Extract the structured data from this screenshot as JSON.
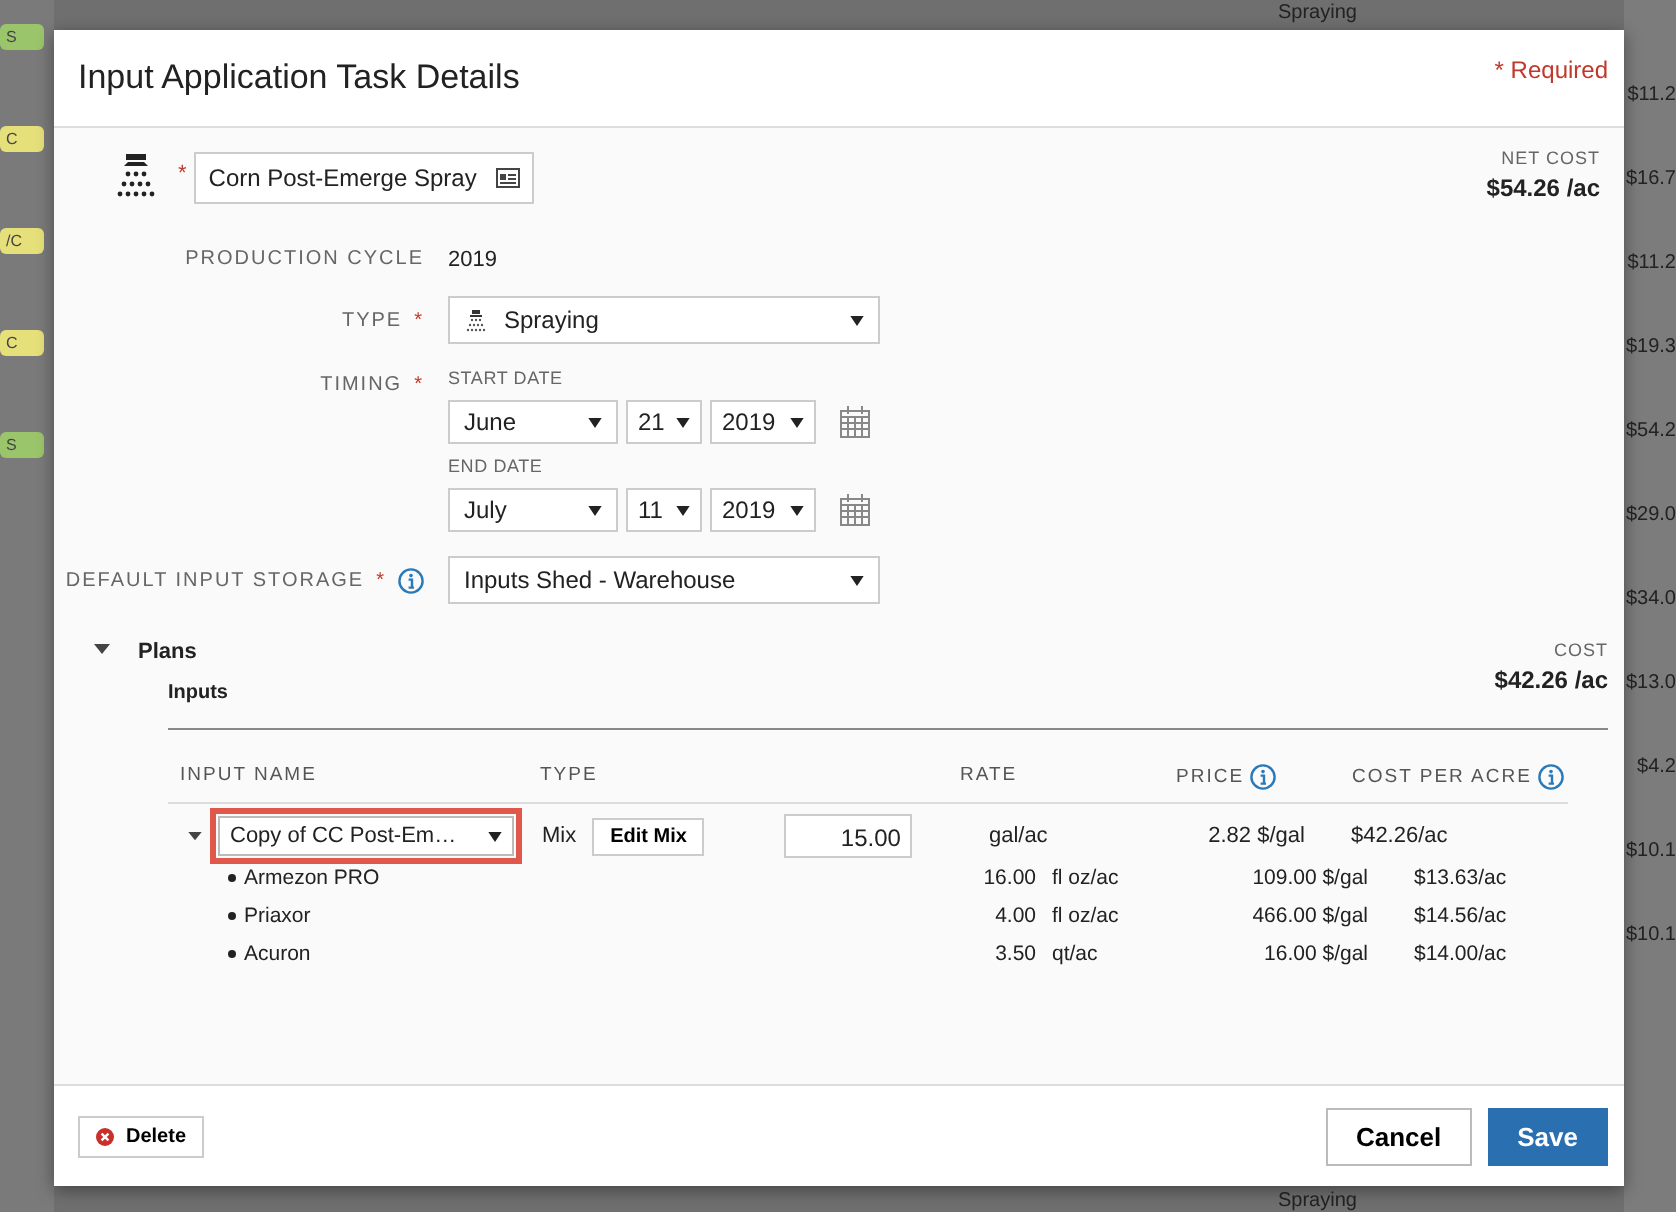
{
  "background": {
    "left_tags": [
      {
        "label": "S",
        "color": "#9bc56a"
      },
      {
        "label": "C",
        "color": "#e6e07a"
      },
      {
        "label": "/C",
        "color": "#e6e07a"
      },
      {
        "label": "C",
        "color": "#e6e07a"
      },
      {
        "label": "S",
        "color": "#9bc56a"
      }
    ],
    "right_top": "Spraying",
    "right_values": [
      "$11.2",
      "$16.7",
      "$11.2",
      "$19.3",
      "$54.2",
      "$29.0",
      "$34.0",
      "$13.0",
      "$4.2",
      "$10.1",
      "$10.1"
    ],
    "right_bottom": "Spraying"
  },
  "dialog": {
    "title": "Input Application Task Details",
    "required_note": "* Required",
    "task_name_mark": "*",
    "task_name": "Corn Post-Emerge Spray",
    "net_cost_label": "NET COST",
    "net_cost": "$54.26 /ac",
    "production_cycle": {
      "label": "PRODUCTION CYCLE",
      "value": "2019"
    },
    "type": {
      "label": "TYPE",
      "required_mark": "*",
      "value": "Spraying"
    },
    "timing": {
      "label": "TIMING",
      "required_mark": "*",
      "start_label": "START DATE",
      "start": {
        "month": "June",
        "day": "21",
        "year": "2019"
      },
      "end_label": "END DATE",
      "end": {
        "month": "July",
        "day": "11",
        "year": "2019"
      }
    },
    "storage": {
      "label": "DEFAULT INPUT STORAGE",
      "required_mark": "*",
      "value": "Inputs Shed - Warehouse"
    },
    "plans": {
      "title": "Plans",
      "expanded": true,
      "cost_label": "COST",
      "cost": "$42.26 /ac",
      "inputs_title": "Inputs",
      "columns": [
        "INPUT NAME",
        "TYPE",
        "RATE",
        "PRICE",
        "COST PER ACRE"
      ],
      "mix": {
        "name": "Copy of CC Post-Em…",
        "expanded": true,
        "highlighted": true,
        "type": "Mix",
        "edit_button": "Edit Mix",
        "rate": "15.00",
        "unit": "gal/ac",
        "price": "2.82 $/gal",
        "cost": "$42.26/ac",
        "children": [
          {
            "name": "Armezon PRO",
            "rate": "16.00",
            "unit": "fl oz/ac",
            "price": "109.00 $/gal",
            "cost": "$13.63/ac"
          },
          {
            "name": "Priaxor",
            "rate": "4.00",
            "unit": "fl oz/ac",
            "price": "466.00 $/gal",
            "cost": "$14.56/ac"
          },
          {
            "name": "Acuron",
            "rate": "3.50",
            "unit": "qt/ac",
            "price": "16.00 $/gal",
            "cost": "$14.00/ac"
          }
        ]
      }
    },
    "buttons": {
      "delete": "Delete",
      "cancel": "Cancel",
      "save": "Save"
    }
  }
}
